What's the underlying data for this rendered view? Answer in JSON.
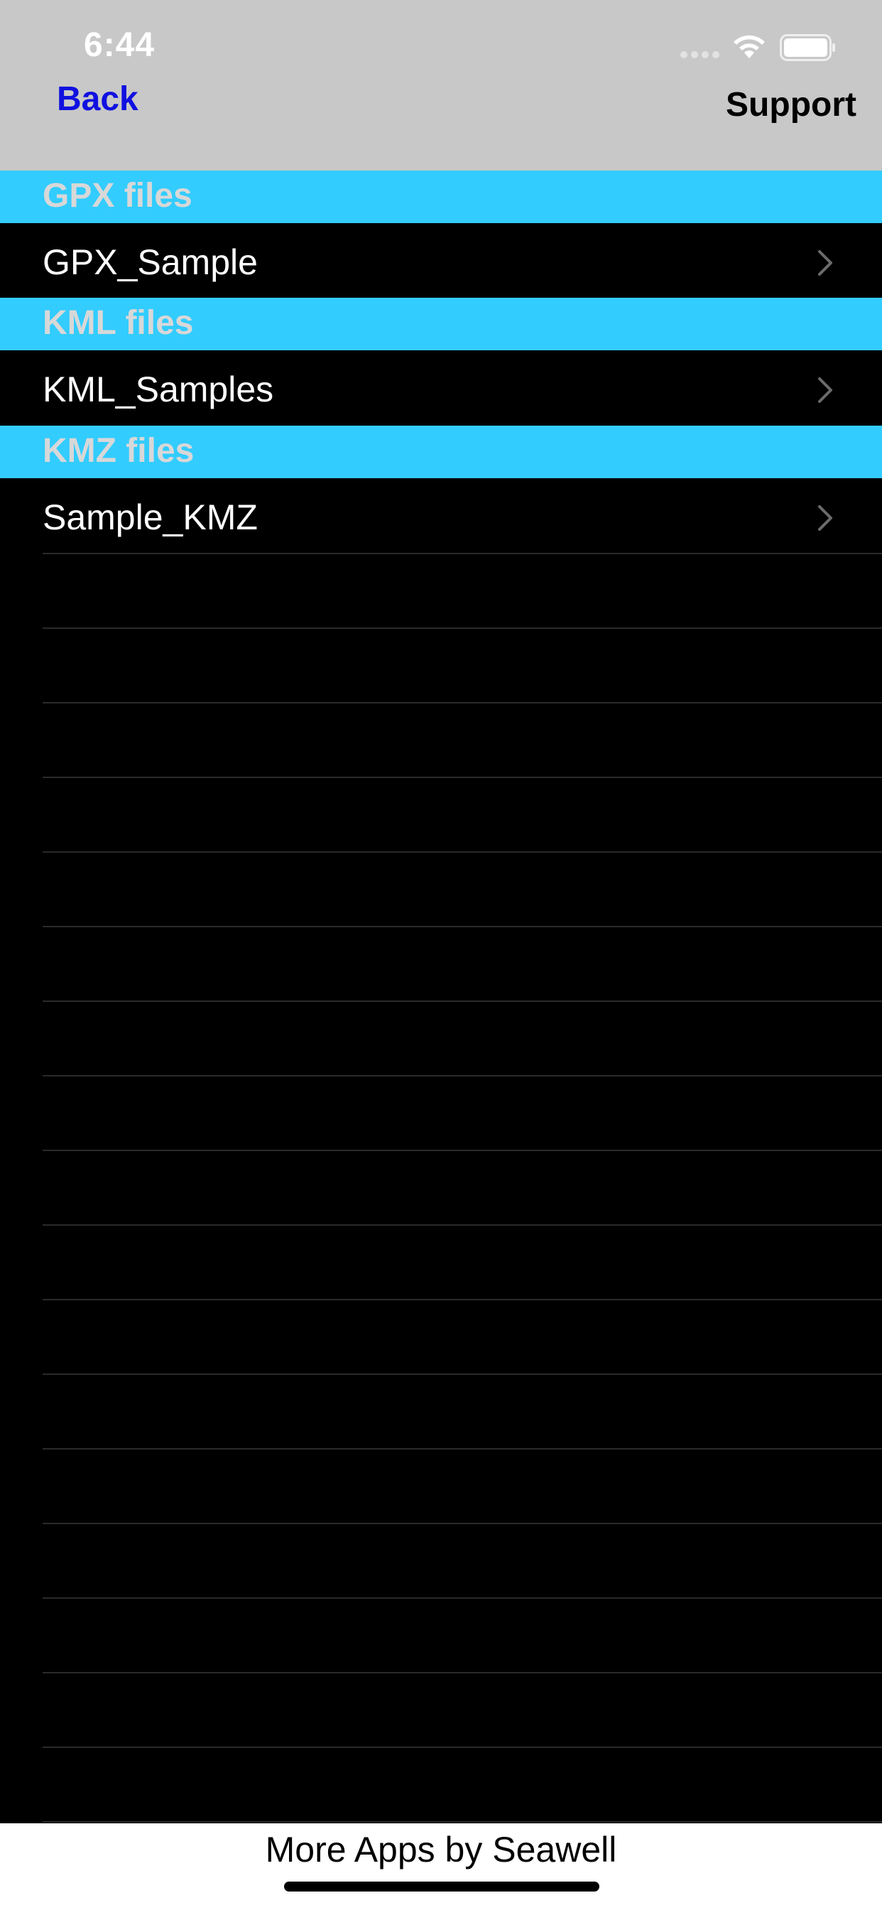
{
  "status_bar": {
    "time": "6:44",
    "icons": [
      "signal-dots-icon",
      "wifi-icon",
      "battery-icon"
    ]
  },
  "nav": {
    "back_label": "Back",
    "support_label": "Support",
    "back_color": "#1010e0"
  },
  "sections": [
    {
      "header": "GPX files",
      "items": [
        {
          "label": "GPX_Sample"
        }
      ]
    },
    {
      "header": "KML files",
      "items": [
        {
          "label": "KML_Samples"
        }
      ]
    },
    {
      "header": "KMZ files",
      "items": [
        {
          "label": "Sample_KMZ"
        }
      ]
    }
  ],
  "colors": {
    "section_header_bg": "#33ccff",
    "section_header_text": "#d8d8d8",
    "list_bg": "#000000",
    "status_bar_bg": "#c8c8c8"
  },
  "footer": {
    "label": "More Apps by Seawell"
  }
}
